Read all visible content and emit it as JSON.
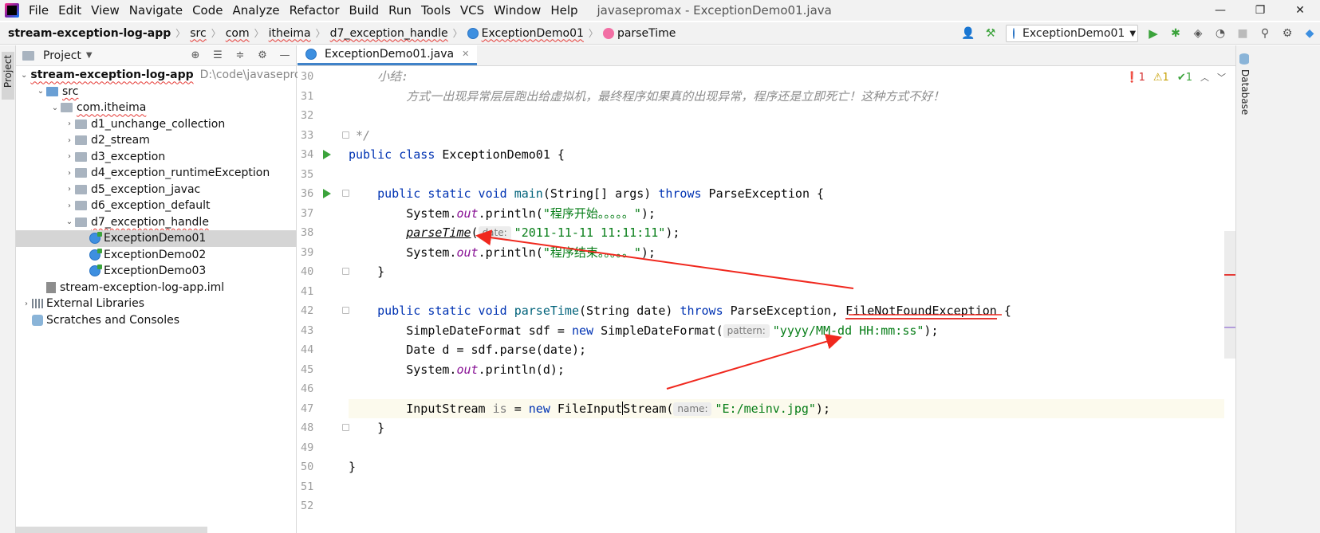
{
  "window": {
    "menu": [
      "File",
      "Edit",
      "View",
      "Navigate",
      "Code",
      "Analyze",
      "Refactor",
      "Build",
      "Run",
      "Tools",
      "VCS",
      "Window",
      "Help"
    ],
    "title": "javasepromax - ExceptionDemo01.java",
    "controls": [
      "—",
      "❐",
      "✕"
    ]
  },
  "breadcrumb": {
    "project": "stream-exception-log-app",
    "items": [
      "src",
      "com",
      "itheima",
      "d7_exception_handle",
      "ExceptionDemo01",
      "parseTime"
    ]
  },
  "toolbar": {
    "run_config": "ExceptionDemo01"
  },
  "left_strip": {
    "project_tab": "Project"
  },
  "project_panel": {
    "title": "Project",
    "tree": [
      {
        "label": "stream-exception-log-app",
        "hint": "D:\\code\\javasepromax\\",
        "level": 0,
        "icon": "module",
        "expanded": true,
        "bold": true,
        "error": true
      },
      {
        "label": "src",
        "level": 1,
        "icon": "source-folder",
        "expanded": true,
        "error": true
      },
      {
        "label": "com.itheima",
        "level": 2,
        "icon": "package",
        "expanded": true,
        "error": true
      },
      {
        "label": "d1_unchange_collection",
        "level": 3,
        "icon": "package",
        "expanded": false
      },
      {
        "label": "d2_stream",
        "level": 3,
        "icon": "package",
        "expanded": false
      },
      {
        "label": "d3_exception",
        "level": 3,
        "icon": "package",
        "expanded": false
      },
      {
        "label": "d4_exception_runtimeException",
        "level": 3,
        "icon": "package",
        "expanded": false
      },
      {
        "label": "d5_exception_javac",
        "level": 3,
        "icon": "package",
        "expanded": false
      },
      {
        "label": "d6_exception_default",
        "level": 3,
        "icon": "package",
        "expanded": false
      },
      {
        "label": "d7_exception_handle",
        "level": 3,
        "icon": "package",
        "expanded": true,
        "error": true
      },
      {
        "label": "ExceptionDemo01",
        "level": 4,
        "icon": "class",
        "selected": true
      },
      {
        "label": "ExceptionDemo02",
        "level": 4,
        "icon": "class"
      },
      {
        "label": "ExceptionDemo03",
        "level": 4,
        "icon": "class"
      },
      {
        "label": "stream-exception-log-app.iml",
        "level": 1,
        "icon": "iml"
      },
      {
        "label": "External Libraries",
        "level": 0,
        "icon": "library",
        "expanded": false
      },
      {
        "label": "Scratches and Consoles",
        "level": 0,
        "icon": "scratch"
      }
    ]
  },
  "editor": {
    "tab": "ExceptionDemo01.java",
    "inspections": {
      "errors": "1",
      "warnings": "1",
      "weak": "1"
    },
    "line_numbers": [
      "30",
      "31",
      "32",
      "33",
      "34",
      "35",
      "36",
      "37",
      "38",
      "39",
      "40",
      "41",
      "42",
      "43",
      "44",
      "45",
      "46",
      "47",
      "48",
      "49",
      "50",
      "51",
      "52"
    ],
    "code": {
      "l30": "    小结:",
      "l31": "        方式一出现异常层层跑出给虚拟机，最终程序如果真的出现异常，程序还是立即死亡！这种方式不好！",
      "l33": " */",
      "l34_kw": "public class",
      "l34_rest": " ExceptionDemo01 {",
      "l36_kw": "public static void",
      "l36_fn": "main",
      "l36_mid": "(String[] args) ",
      "l36_throws": "throws",
      "l36_rest": " ParseException {",
      "l37_a": "System.",
      "l37_out": "out",
      "l37_b": ".println(",
      "l37_str": "\"程序开始。。。。。\"",
      "l37_c": ");",
      "l38_call": "parseTime",
      "l38_open": "(",
      "l38_hint": "date:",
      "l38_str": "\"2011-11-11 11:11:11\"",
      "l38_close": ");",
      "l39_a": "System.",
      "l39_out": "out",
      "l39_b": ".println(",
      "l39_str": "\"程序结束。。。。。\"",
      "l39_c": ");",
      "l40": "}",
      "l42_kw": "public static void",
      "l42_fn": "parseTime",
      "l42_mid": "(String date) ",
      "l42_throws": "throws",
      "l42_pe": " ParseException, ",
      "l42_fnf": "FileNotFoundException",
      "l42_rest": " {",
      "l43_a": "SimpleDateFormat sdf = ",
      "l43_new": "new",
      "l43_b": " SimpleDateFormat(",
      "l43_hint": "pattern:",
      "l43_str": "\"yyyy/MM-dd HH:mm:ss\"",
      "l43_c": ");",
      "l44": "Date d = sdf.parse(date);",
      "l45_a": "System.",
      "l45_out": "out",
      "l45_b": ".println(d);",
      "l47_a": "InputStream ",
      "l47_var": "is",
      "l47_b": " = ",
      "l47_new": "new",
      "l47_c1": " FileInput",
      "l47_c2": "Stream(",
      "l47_hint": "name:",
      "l47_str": "\"E:/meinv.jpg\"",
      "l47_d": ");",
      "l48": "}",
      "l50": "}"
    }
  },
  "right_strip": {
    "database_tab": "Database"
  },
  "colors": {
    "accent": "#4083c9",
    "run_green": "#3ba33b",
    "error_red": "#e53935",
    "annotation_red": "#f0281e"
  }
}
